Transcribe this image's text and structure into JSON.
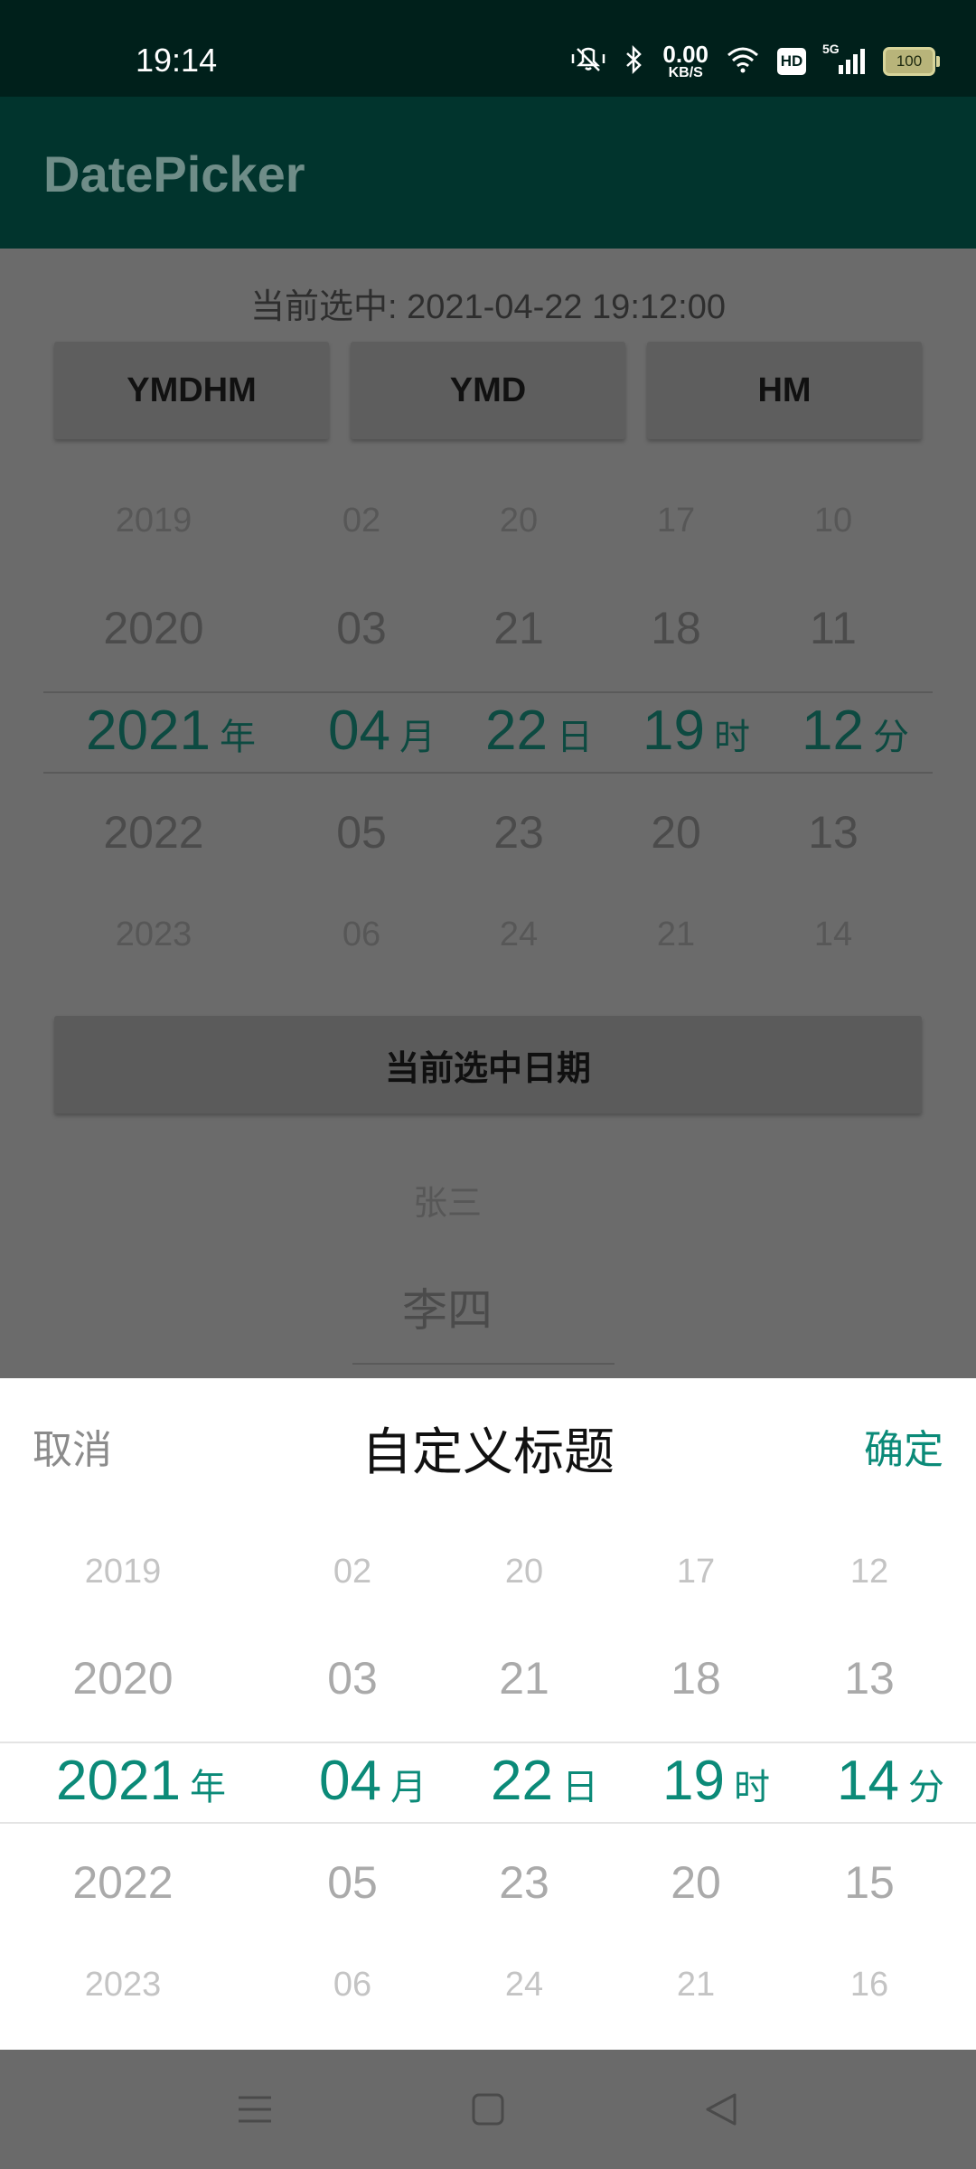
{
  "status_bar": {
    "time": "19:14",
    "net_speed_value": "0.00",
    "net_speed_unit": "KB/S",
    "hd_badge": "HD",
    "network_type": "5G",
    "battery": "100",
    "icons": [
      "mute-vibrate-icon",
      "bluetooth-icon",
      "wifi-icon",
      "hd-icon",
      "signal-icon",
      "battery-icon"
    ]
  },
  "app_bar": {
    "title": "DatePicker"
  },
  "main": {
    "current_label": "当前选中: 2021-04-22 19:12:00",
    "mode_buttons": [
      "YMDHM",
      "YMD",
      "HM"
    ],
    "wheel": {
      "columns": [
        {
          "unit": "年",
          "items": [
            "2019",
            "2020",
            "2021",
            "2022",
            "2023"
          ]
        },
        {
          "unit": "月",
          "items": [
            "02",
            "03",
            "04",
            "05",
            "06"
          ]
        },
        {
          "unit": "日",
          "items": [
            "20",
            "21",
            "22",
            "23",
            "24"
          ]
        },
        {
          "unit": "时",
          "items": [
            "17",
            "18",
            "19",
            "20",
            "21"
          ]
        },
        {
          "unit": "分",
          "items": [
            "10",
            "11",
            "12",
            "13",
            "14"
          ]
        }
      ]
    },
    "current_date_button": "当前选中日期",
    "names": [
      "张三",
      "李四"
    ]
  },
  "sheet": {
    "cancel": "取消",
    "title": "自定义标题",
    "confirm": "确定",
    "wheel": {
      "columns": [
        {
          "unit": "年",
          "items": [
            "2019",
            "2020",
            "2021",
            "2022",
            "2023"
          ]
        },
        {
          "unit": "月",
          "items": [
            "02",
            "03",
            "04",
            "05",
            "06"
          ]
        },
        {
          "unit": "日",
          "items": [
            "20",
            "21",
            "22",
            "23",
            "24"
          ]
        },
        {
          "unit": "时",
          "items": [
            "17",
            "18",
            "19",
            "20",
            "21"
          ]
        },
        {
          "unit": "分",
          "items": [
            "12",
            "13",
            "14",
            "15",
            "16"
          ]
        }
      ]
    }
  },
  "nav_bar": {
    "icons": [
      "menu-icon",
      "home-icon",
      "back-icon"
    ]
  },
  "colors": {
    "accent": "#0b8a78",
    "app_bar": "#01342d",
    "status_bar": "#00201b",
    "scrim": "#6b6b6b"
  }
}
